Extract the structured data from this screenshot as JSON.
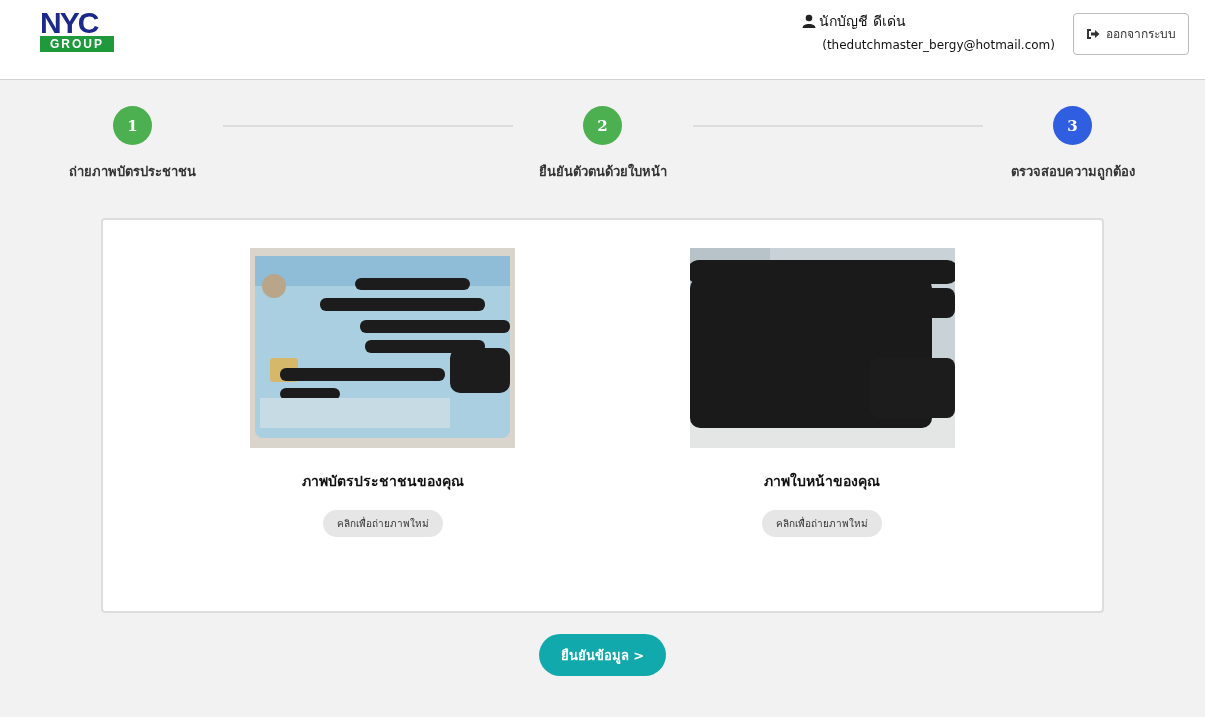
{
  "header": {
    "logo": {
      "top": "NYC",
      "bottom": "GROUP"
    },
    "user_name": "นักบัญชี ดีเด่น",
    "user_email": "(thedutchmaster_bergy@hotmail.com)",
    "logout_button": "ออกจากระบบ"
  },
  "steps": [
    {
      "number": "1",
      "label": "ถ่ายภาพบัตรประชาชน",
      "color": "#4caf50"
    },
    {
      "number": "2",
      "label": "ยืนยันตัวตนด้วยใบหน้า",
      "color": "#4caf50"
    },
    {
      "number": "3",
      "label": "ตรวจสอบความถูกต้อง",
      "color": "#2f5fe0"
    }
  ],
  "photos": [
    {
      "kind": "picture",
      "caption": "ภาพบัตรประชาชนของคุณ",
      "retake_button": "คลิกเพื่อถ่ายภาพใหม่"
    },
    {
      "kind": "picture",
      "caption": "ภาพใบหน้าของคุณ",
      "retake_button": "คลิกเพื่อถ่ายภาพใหม่"
    }
  ],
  "confirm_button": "ยืนยันข้อมูล >"
}
